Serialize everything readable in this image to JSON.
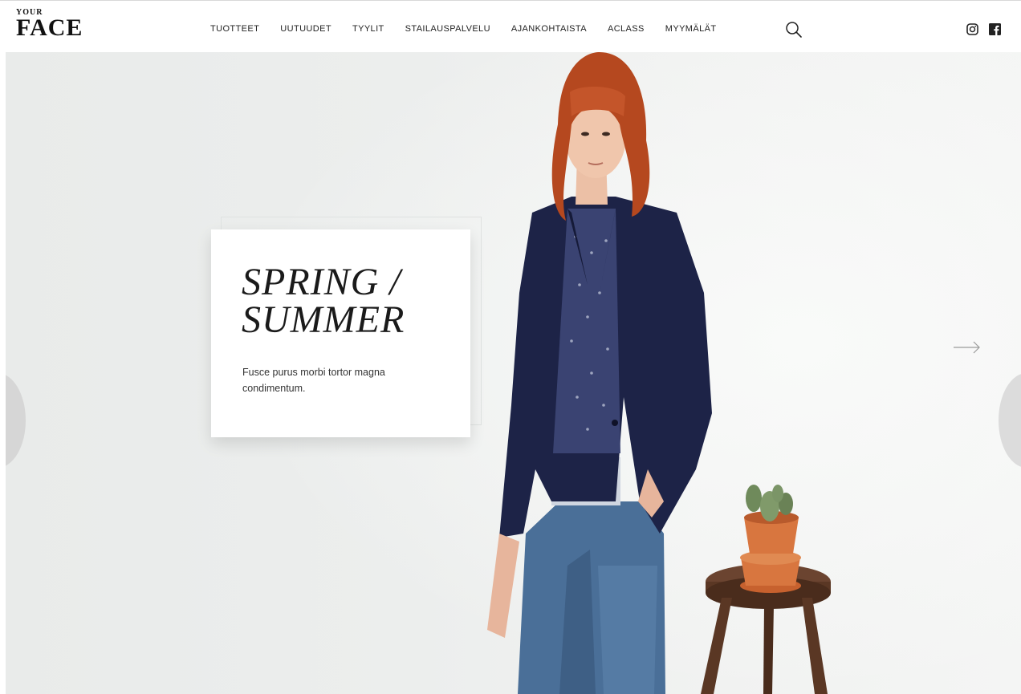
{
  "brand": {
    "small": "YOUR",
    "big": "FACE"
  },
  "nav": {
    "items": [
      {
        "label": "TUOTTEET"
      },
      {
        "label": "UUTUUDET"
      },
      {
        "label": "TYYLIT"
      },
      {
        "label": "STAILAUSPALVELU"
      },
      {
        "label": "AJANKOHTAISTA"
      },
      {
        "label": "ACLASS"
      },
      {
        "label": "MYYMÄLÄT"
      }
    ]
  },
  "icons": {
    "search": "search-icon",
    "instagram": "instagram-icon",
    "facebook": "facebook-icon",
    "next": "arrow-right-icon"
  },
  "hero": {
    "title_line1": "SPRING /",
    "title_line2": "SUMMER",
    "text": "Fusce purus morbi tortor magna condimentum."
  },
  "colors": {
    "jacket": "#1d2347",
    "hair": "#b5481f",
    "jeans": "#4a6f98",
    "pot": "#d8763f",
    "stool": "#5a3724"
  }
}
